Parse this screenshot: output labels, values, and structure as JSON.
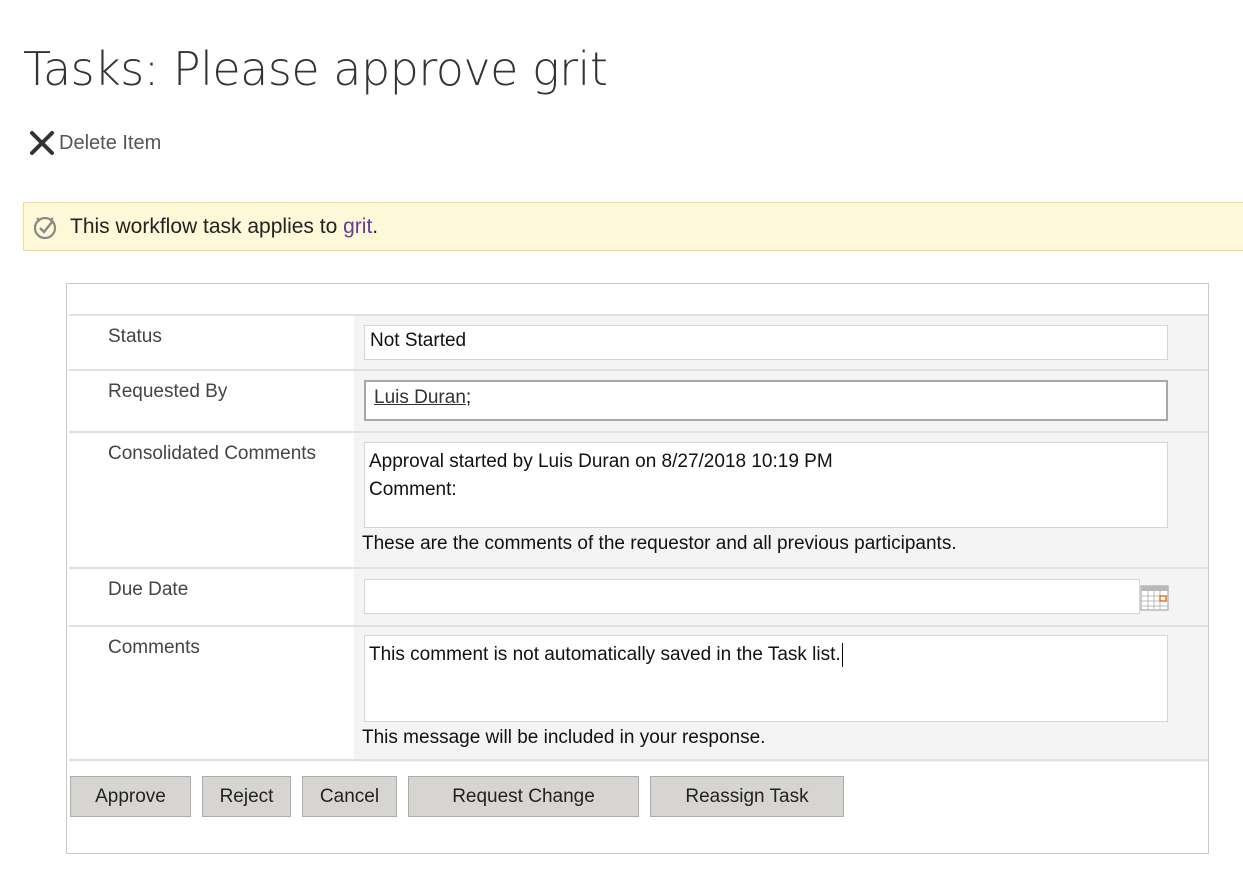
{
  "page": {
    "title": "Tasks: Please approve grit"
  },
  "toolbar": {
    "delete_label": "Delete Item"
  },
  "banner": {
    "prefix": "This workflow task applies to ",
    "link_text": "grit",
    "suffix": "."
  },
  "form": {
    "status": {
      "label": "Status",
      "value": "Not Started"
    },
    "requested_by": {
      "label": "Requested By",
      "person": "Luis Duran",
      "separator": ";"
    },
    "consolidated_comments": {
      "label": "Consolidated Comments",
      "line1": "Approval started by Luis Duran on 8/27/2018 10:19 PM",
      "line2": "Comment:",
      "hint": "These are the comments of the requestor and all previous participants."
    },
    "due_date": {
      "label": "Due Date",
      "value": ""
    },
    "comments": {
      "label": "Comments",
      "value": "This comment is not automatically saved in the Task list.",
      "hint": "This message will be included in your response."
    }
  },
  "buttons": {
    "approve": "Approve",
    "reject": "Reject",
    "cancel": "Cancel",
    "request_change": "Request Change",
    "reassign_task": "Reassign Task"
  },
  "colors": {
    "banner_bg": "#fdf8d7",
    "banner_border": "#f0e08c",
    "link": "#6a3b9a",
    "button_bg": "#d7d5d2",
    "value_area_bg": "#f4f4f5"
  }
}
